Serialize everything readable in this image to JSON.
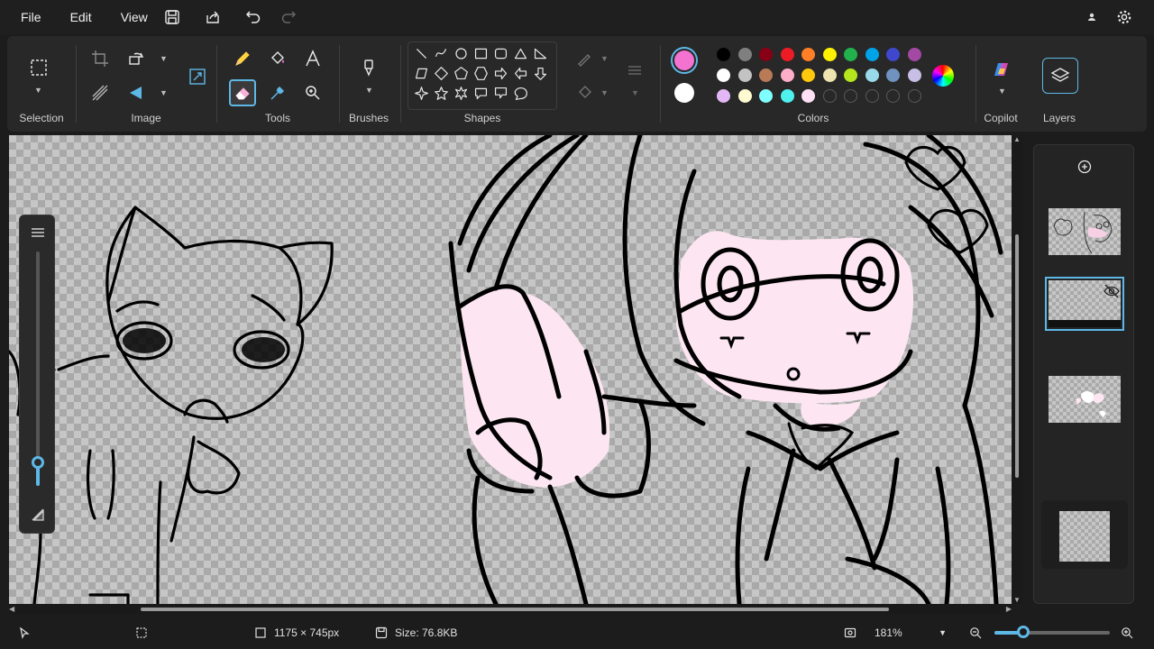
{
  "menu": {
    "file": "File",
    "edit": "Edit",
    "view": "View"
  },
  "ribbon": {
    "selection": "Selection",
    "image": "Image",
    "tools": "Tools",
    "brushes": "Brushes",
    "shapes": "Shapes",
    "colors": "Colors",
    "copilot": "Copilot",
    "layers": "Layers"
  },
  "colors": {
    "primary": "#f472d0",
    "secondary": "#ffffff",
    "palette_row1": [
      "#000000",
      "#7f7f7f",
      "#880015",
      "#ed1c24",
      "#ff7f27",
      "#fff200",
      "#22b14c",
      "#00a2e8",
      "#3f48cc",
      "#a349a4"
    ],
    "palette_row2": [
      "#ffffff",
      "#c3c3c3",
      "#b97a57",
      "#ffaec9",
      "#ffc90e",
      "#efe4b0",
      "#b5e61d",
      "#99d9ea",
      "#7092be",
      "#c8bfe7"
    ],
    "palette_row3": [
      "#e3b6f5",
      "#fffbd0",
      "#80ffff",
      "#4ff0f0",
      "#ffe0f5",
      "",
      "",
      "",
      "",
      ""
    ]
  },
  "status": {
    "canvas_size": "1175 × 745px",
    "file_size": "Size: 76.8KB",
    "zoom": "181%"
  },
  "brush_size_fraction": 0.1,
  "zoom_slider_fraction": 0.25
}
